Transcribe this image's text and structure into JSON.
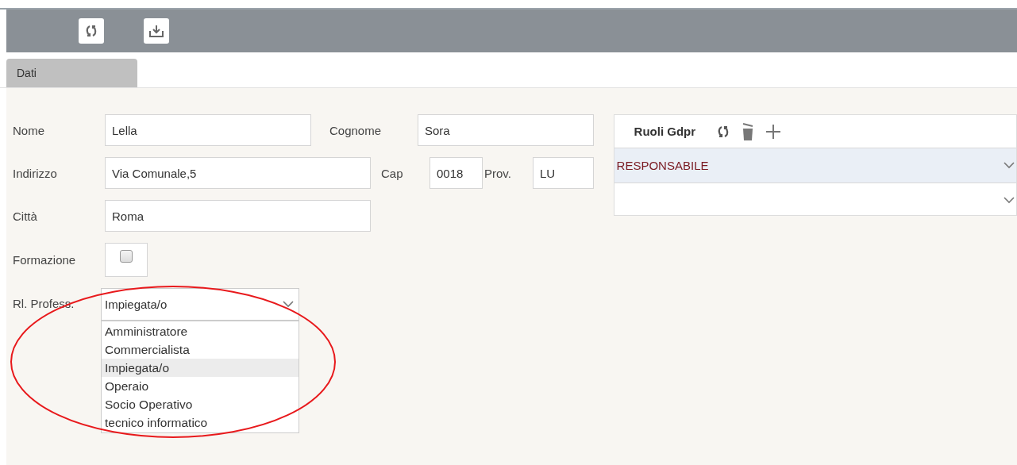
{
  "toolbar": {
    "buttons": [
      {
        "kind": "refresh"
      },
      {
        "kind": "download"
      }
    ]
  },
  "tabs": [
    {
      "label": "Dati",
      "selected": true
    }
  ],
  "form": {
    "nome": {
      "label": "Nome",
      "value": "Lella"
    },
    "cognome": {
      "label": "Cognome",
      "value": "Sora"
    },
    "indirizzo": {
      "label": "Indirizzo",
      "value": "Via Comunale,5"
    },
    "cap": {
      "label": "Cap",
      "value": "0018"
    },
    "prov": {
      "label": "Prov.",
      "value": "LU"
    },
    "citta": {
      "label": "Città",
      "value": "Roma"
    },
    "formazione": {
      "label": "Formazione",
      "checked": false
    },
    "professione": {
      "label": "Rl. Profess.",
      "value": "Impiegata/o",
      "expanded": true,
      "options": [
        {
          "label": "Amministratore",
          "selected": false
        },
        {
          "label": "Commercialista",
          "selected": false
        },
        {
          "label": "Impiegata/o",
          "selected": true
        },
        {
          "label": "Operaio",
          "selected": false
        },
        {
          "label": "Socio Operativo",
          "selected": false
        },
        {
          "label": "tecnico informatico",
          "selected": false
        }
      ]
    }
  },
  "roles_panel": {
    "title": "Ruoli Gdpr",
    "actions": [
      {
        "kind": "refresh"
      },
      {
        "kind": "delete"
      },
      {
        "kind": "add"
      }
    ],
    "rows": [
      {
        "value": "RESPONSABILE",
        "selected": true
      },
      {
        "value": "",
        "selected": false
      }
    ]
  },
  "annotation": {
    "kind": "ellipse",
    "color": "#e8191c"
  }
}
